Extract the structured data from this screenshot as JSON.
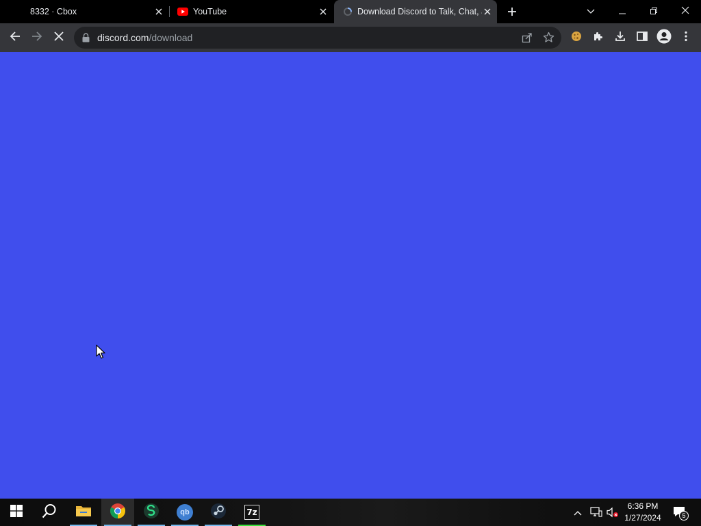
{
  "browser": {
    "tabs": [
      {
        "title": "8332 · Cbox",
        "icon": "blank",
        "active": false
      },
      {
        "title": "YouTube",
        "icon": "youtube-icon",
        "active": false
      },
      {
        "title": "Download Discord to Talk, Chat, and Hang Out",
        "icon": "loading-icon",
        "active": true
      }
    ],
    "url_host": "discord.com",
    "url_path": "/download"
  },
  "page": {
    "background_color": "#404eed"
  },
  "taskbar": {
    "apps": [
      "windows-start-icon",
      "search-icon",
      "file-explorer-icon",
      "chrome-icon",
      "app-s-icon",
      "qbittorrent-icon",
      "steam-icon",
      "7zip-icon"
    ],
    "qb_label": "qb",
    "sevenzip_label": "7z",
    "time": "6:36 PM",
    "date": "1/27/2024",
    "notification_count": "5"
  }
}
